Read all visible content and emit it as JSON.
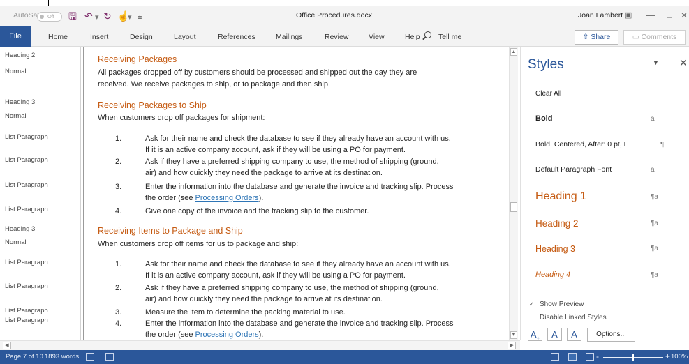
{
  "titlebar": {
    "autosave_label": "AutoSave",
    "autosave_state": "Off",
    "doc_title": "Office Procedures.docx",
    "user_name": "Joan Lambert",
    "icons": [
      "save-icon",
      "undo-icon",
      "redo-icon",
      "touch-mode-icon",
      "customize-icon",
      "ribbon-display-icon",
      "minimize-icon",
      "maximize-icon",
      "close-icon"
    ]
  },
  "ribbon": {
    "tabs": [
      "File",
      "Home",
      "Insert",
      "Design",
      "Layout",
      "References",
      "Mailings",
      "Review",
      "View",
      "Help"
    ],
    "tell_me": "Tell me",
    "share": "Share",
    "comments": "Comments"
  },
  "style_area": {
    "labels": [
      "Heading 2",
      "Normal",
      "Heading 3",
      "Normal",
      "List Paragraph",
      "List Paragraph",
      "List Paragraph",
      "List Paragraph",
      "Heading 3",
      "Normal",
      "List Paragraph",
      "List Paragraph",
      "List Paragraph",
      "List Paragraph"
    ]
  },
  "document": {
    "h1": "Receiving Packages",
    "p1": [
      "All packages dropped off by customers should be processed and shipped out the day they are",
      "received. We receive packages to ship, or to package and then ship."
    ],
    "h2": "Receiving Packages to Ship",
    "p2": "When customers drop off packages for shipment:",
    "list1": [
      {
        "num": "1.",
        "lines": [
          "Ask for their name and check the database to see if they already have an account with us.",
          "If it is an active company account, ask if they will be using a PO for payment."
        ]
      },
      {
        "num": "2.",
        "lines": [
          "Ask if they have a preferred shipping company to use, the method of shipping (ground,",
          "air) and how quickly they need the package to arrive at its destination."
        ]
      },
      {
        "num": "3.",
        "lines": [
          "Enter the information into the database and generate the invoice and tracking slip. Process"
        ],
        "pre": "the order (see ",
        "link": "Processing Orders",
        "post": ")."
      },
      {
        "num": "4.",
        "lines": [
          "Give one copy of the invoice and the tracking slip to the customer."
        ]
      }
    ],
    "h3": "Receiving Items to Package and Ship",
    "p3": "When customers drop off items for us to package and ship:",
    "list2": [
      {
        "num": "1.",
        "lines": [
          "Ask for their name and check the database to see if they already have an account with us.",
          "If it is an active company account, ask if they will be using a PO for payment."
        ]
      },
      {
        "num": "2.",
        "lines": [
          "Ask if they have a preferred shipping company to use, the method of shipping (ground,",
          "air) and how quickly they need the package to arrive at its destination."
        ]
      },
      {
        "num": "3.",
        "lines": [
          "Measure the item to determine the packing material to use."
        ]
      },
      {
        "num": "4.",
        "lines": [
          "Enter the information into the database and generate the invoice and tracking slip. Process"
        ],
        "pre": "the order (see ",
        "link": "Processing Orders",
        "post": ")."
      }
    ]
  },
  "styles_pane": {
    "title": "Styles",
    "items": [
      {
        "label": "Clear All",
        "mark": ""
      },
      {
        "label": "Bold",
        "mark": "a"
      },
      {
        "label": "Bold, Centered, After:  0 pt, L",
        "mark": "¶"
      },
      {
        "label": "Default Paragraph Font",
        "mark": "a"
      },
      {
        "label": "Heading 1",
        "mark": "¶a"
      },
      {
        "label": "Heading 2",
        "mark": "¶a"
      },
      {
        "label": "Heading 3",
        "mark": "¶a"
      },
      {
        "label": "Heading 4",
        "mark": "¶a"
      }
    ],
    "show_preview": "Show Preview",
    "show_preview_checked": true,
    "disable_linked": "Disable Linked Styles",
    "disable_linked_checked": false,
    "options": "Options...",
    "heading_color": "#c55a11"
  },
  "statusbar": {
    "page": "Page 7 of 10",
    "words": "1893 words",
    "zoom": "100%",
    "zoom_minus": "-",
    "zoom_plus": "+",
    "color": "#2b579a"
  }
}
